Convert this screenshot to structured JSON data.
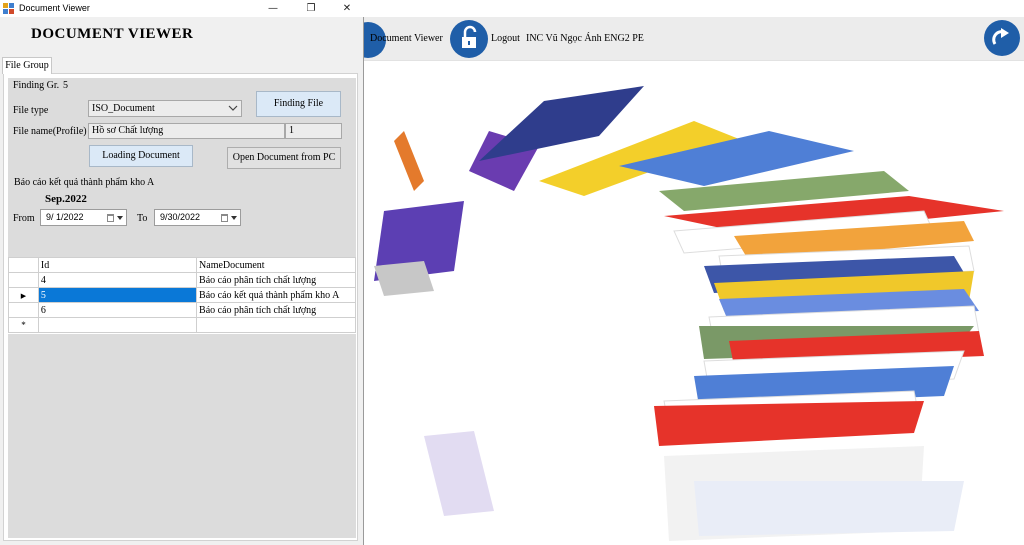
{
  "window": {
    "title": "Document Viewer",
    "controls": [
      "minimize",
      "restore",
      "close"
    ]
  },
  "heading": "DOCUMENT VIEWER",
  "tab": {
    "label": "File Group"
  },
  "form": {
    "finding_group_label": "Finding Gr.",
    "finding_group_value": "5",
    "file_type_label": "File type",
    "file_type_value": "ISO_Document",
    "finding_file_button": "Finding File",
    "file_name_label": "File name(Profile)",
    "file_name_value": "Hồ sơ Chất lượng",
    "file_name_count": "1",
    "loading_button": "Loading Document",
    "open_pc_button": "Open Document from PC",
    "report_title": "Báo cáo kết quả thành phẩm kho A",
    "period": "Sep.2022",
    "from_label": "From",
    "from_date": "9/  1/2022",
    "to_label": "To",
    "to_date": "9/30/2022"
  },
  "grid": {
    "columns": [
      "Id",
      "NameDocument"
    ],
    "rows": [
      {
        "id": "4",
        "name": "Báo cáo phân tích chất lượng"
      },
      {
        "id": "5",
        "name": "Báo cáo kết quả thành phẩm kho A",
        "selected": true
      },
      {
        "id": "6",
        "name": "Báo cáo phân tích chất lượng"
      }
    ]
  },
  "background_app": {
    "doc_viewer_label": "Document Viewer",
    "logout_label": "Logout",
    "user_info": "INC  Vũ Ngọc Ánh  ENG2  PE"
  },
  "colors": {
    "accent_blue": "#1f5ea8",
    "selection": "#0a78d7"
  }
}
